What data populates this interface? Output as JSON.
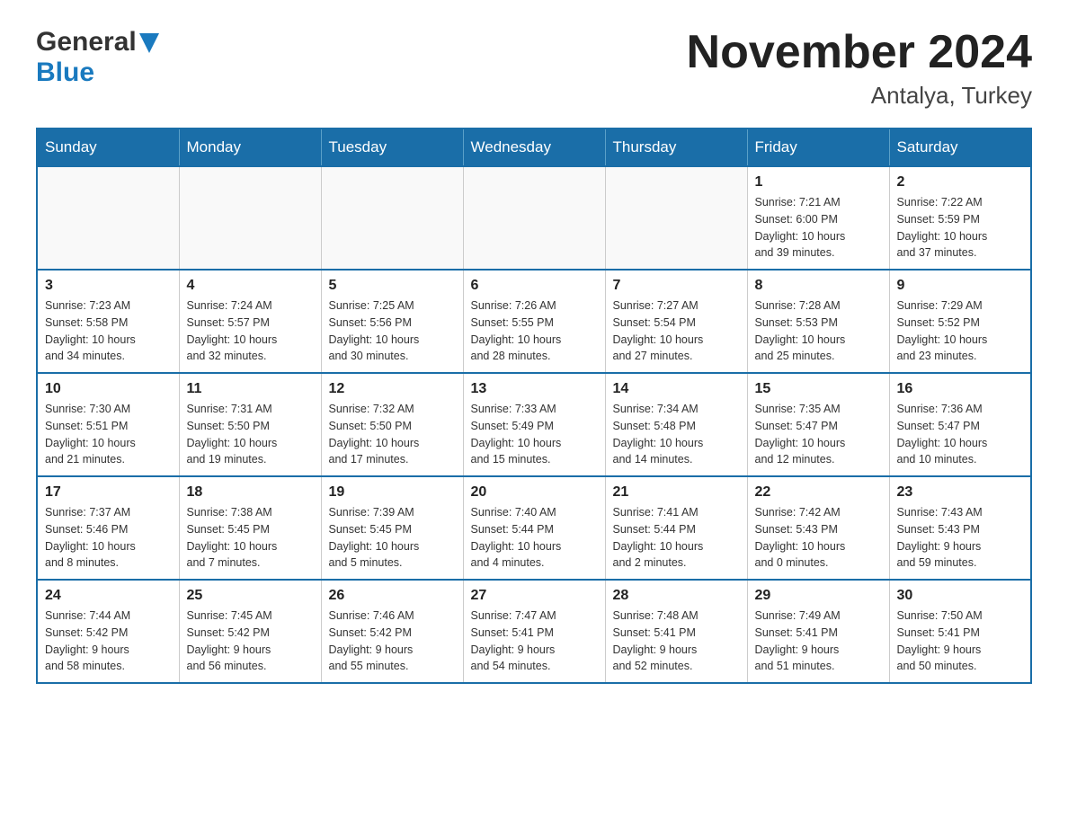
{
  "header": {
    "logo_general": "General",
    "logo_blue": "Blue",
    "month": "November 2024",
    "location": "Antalya, Turkey"
  },
  "days_of_week": [
    "Sunday",
    "Monday",
    "Tuesday",
    "Wednesday",
    "Thursday",
    "Friday",
    "Saturday"
  ],
  "weeks": [
    {
      "days": [
        {
          "number": "",
          "info": ""
        },
        {
          "number": "",
          "info": ""
        },
        {
          "number": "",
          "info": ""
        },
        {
          "number": "",
          "info": ""
        },
        {
          "number": "",
          "info": ""
        },
        {
          "number": "1",
          "info": "Sunrise: 7:21 AM\nSunset: 6:00 PM\nDaylight: 10 hours\nand 39 minutes."
        },
        {
          "number": "2",
          "info": "Sunrise: 7:22 AM\nSunset: 5:59 PM\nDaylight: 10 hours\nand 37 minutes."
        }
      ]
    },
    {
      "days": [
        {
          "number": "3",
          "info": "Sunrise: 7:23 AM\nSunset: 5:58 PM\nDaylight: 10 hours\nand 34 minutes."
        },
        {
          "number": "4",
          "info": "Sunrise: 7:24 AM\nSunset: 5:57 PM\nDaylight: 10 hours\nand 32 minutes."
        },
        {
          "number": "5",
          "info": "Sunrise: 7:25 AM\nSunset: 5:56 PM\nDaylight: 10 hours\nand 30 minutes."
        },
        {
          "number": "6",
          "info": "Sunrise: 7:26 AM\nSunset: 5:55 PM\nDaylight: 10 hours\nand 28 minutes."
        },
        {
          "number": "7",
          "info": "Sunrise: 7:27 AM\nSunset: 5:54 PM\nDaylight: 10 hours\nand 27 minutes."
        },
        {
          "number": "8",
          "info": "Sunrise: 7:28 AM\nSunset: 5:53 PM\nDaylight: 10 hours\nand 25 minutes."
        },
        {
          "number": "9",
          "info": "Sunrise: 7:29 AM\nSunset: 5:52 PM\nDaylight: 10 hours\nand 23 minutes."
        }
      ]
    },
    {
      "days": [
        {
          "number": "10",
          "info": "Sunrise: 7:30 AM\nSunset: 5:51 PM\nDaylight: 10 hours\nand 21 minutes."
        },
        {
          "number": "11",
          "info": "Sunrise: 7:31 AM\nSunset: 5:50 PM\nDaylight: 10 hours\nand 19 minutes."
        },
        {
          "number": "12",
          "info": "Sunrise: 7:32 AM\nSunset: 5:50 PM\nDaylight: 10 hours\nand 17 minutes."
        },
        {
          "number": "13",
          "info": "Sunrise: 7:33 AM\nSunset: 5:49 PM\nDaylight: 10 hours\nand 15 minutes."
        },
        {
          "number": "14",
          "info": "Sunrise: 7:34 AM\nSunset: 5:48 PM\nDaylight: 10 hours\nand 14 minutes."
        },
        {
          "number": "15",
          "info": "Sunrise: 7:35 AM\nSunset: 5:47 PM\nDaylight: 10 hours\nand 12 minutes."
        },
        {
          "number": "16",
          "info": "Sunrise: 7:36 AM\nSunset: 5:47 PM\nDaylight: 10 hours\nand 10 minutes."
        }
      ]
    },
    {
      "days": [
        {
          "number": "17",
          "info": "Sunrise: 7:37 AM\nSunset: 5:46 PM\nDaylight: 10 hours\nand 8 minutes."
        },
        {
          "number": "18",
          "info": "Sunrise: 7:38 AM\nSunset: 5:45 PM\nDaylight: 10 hours\nand 7 minutes."
        },
        {
          "number": "19",
          "info": "Sunrise: 7:39 AM\nSunset: 5:45 PM\nDaylight: 10 hours\nand 5 minutes."
        },
        {
          "number": "20",
          "info": "Sunrise: 7:40 AM\nSunset: 5:44 PM\nDaylight: 10 hours\nand 4 minutes."
        },
        {
          "number": "21",
          "info": "Sunrise: 7:41 AM\nSunset: 5:44 PM\nDaylight: 10 hours\nand 2 minutes."
        },
        {
          "number": "22",
          "info": "Sunrise: 7:42 AM\nSunset: 5:43 PM\nDaylight: 10 hours\nand 0 minutes."
        },
        {
          "number": "23",
          "info": "Sunrise: 7:43 AM\nSunset: 5:43 PM\nDaylight: 9 hours\nand 59 minutes."
        }
      ]
    },
    {
      "days": [
        {
          "number": "24",
          "info": "Sunrise: 7:44 AM\nSunset: 5:42 PM\nDaylight: 9 hours\nand 58 minutes."
        },
        {
          "number": "25",
          "info": "Sunrise: 7:45 AM\nSunset: 5:42 PM\nDaylight: 9 hours\nand 56 minutes."
        },
        {
          "number": "26",
          "info": "Sunrise: 7:46 AM\nSunset: 5:42 PM\nDaylight: 9 hours\nand 55 minutes."
        },
        {
          "number": "27",
          "info": "Sunrise: 7:47 AM\nSunset: 5:41 PM\nDaylight: 9 hours\nand 54 minutes."
        },
        {
          "number": "28",
          "info": "Sunrise: 7:48 AM\nSunset: 5:41 PM\nDaylight: 9 hours\nand 52 minutes."
        },
        {
          "number": "29",
          "info": "Sunrise: 7:49 AM\nSunset: 5:41 PM\nDaylight: 9 hours\nand 51 minutes."
        },
        {
          "number": "30",
          "info": "Sunrise: 7:50 AM\nSunset: 5:41 PM\nDaylight: 9 hours\nand 50 minutes."
        }
      ]
    }
  ]
}
